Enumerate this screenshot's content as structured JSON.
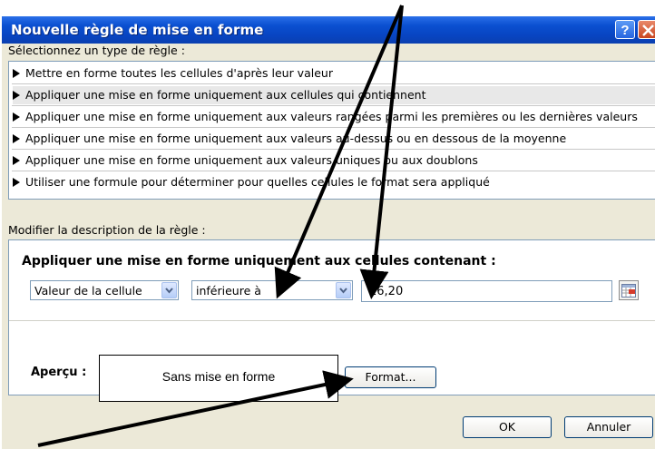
{
  "dialog": {
    "title": "Nouvelle règle de mise en forme",
    "help_label": "?",
    "rule_type_label": "Sélectionnez un type de règle :",
    "rule_types": [
      {
        "label": "Mettre en forme toutes les cellules d'après leur valeur",
        "selected": false
      },
      {
        "label": "Appliquer une mise en forme uniquement aux cellules qui contiennent",
        "selected": true
      },
      {
        "label": "Appliquer une mise en forme uniquement aux valeurs rangées parmi les premières ou les dernières valeurs",
        "selected": false
      },
      {
        "label": "Appliquer une mise en forme uniquement aux valeurs au-dessus ou en dessous de la moyenne",
        "selected": false
      },
      {
        "label": "Appliquer une mise en forme uniquement aux valeurs uniques ou aux doublons",
        "selected": false
      },
      {
        "label": "Utiliser une formule pour déterminer pour quelles cellules le format sera appliqué",
        "selected": false
      }
    ],
    "description_label": "Modifier la description de la règle :",
    "condition": {
      "heading": "Appliquer une mise en forme uniquement aux cellules contenant :",
      "field_value": "Valeur de la cellule",
      "operator_value": "inférieure à",
      "value": "16,20"
    },
    "preview": {
      "label": "Aperçu :",
      "text": "Sans mise en forme",
      "format_button": "Format..."
    },
    "buttons": {
      "ok": "OK",
      "cancel": "Annuler"
    }
  },
  "colors": {
    "titlebar": "#0a4fd0",
    "dialog_bg": "#ece9d8",
    "selected_row": "#e8e8e8",
    "annotation_arrows": "#000000"
  }
}
